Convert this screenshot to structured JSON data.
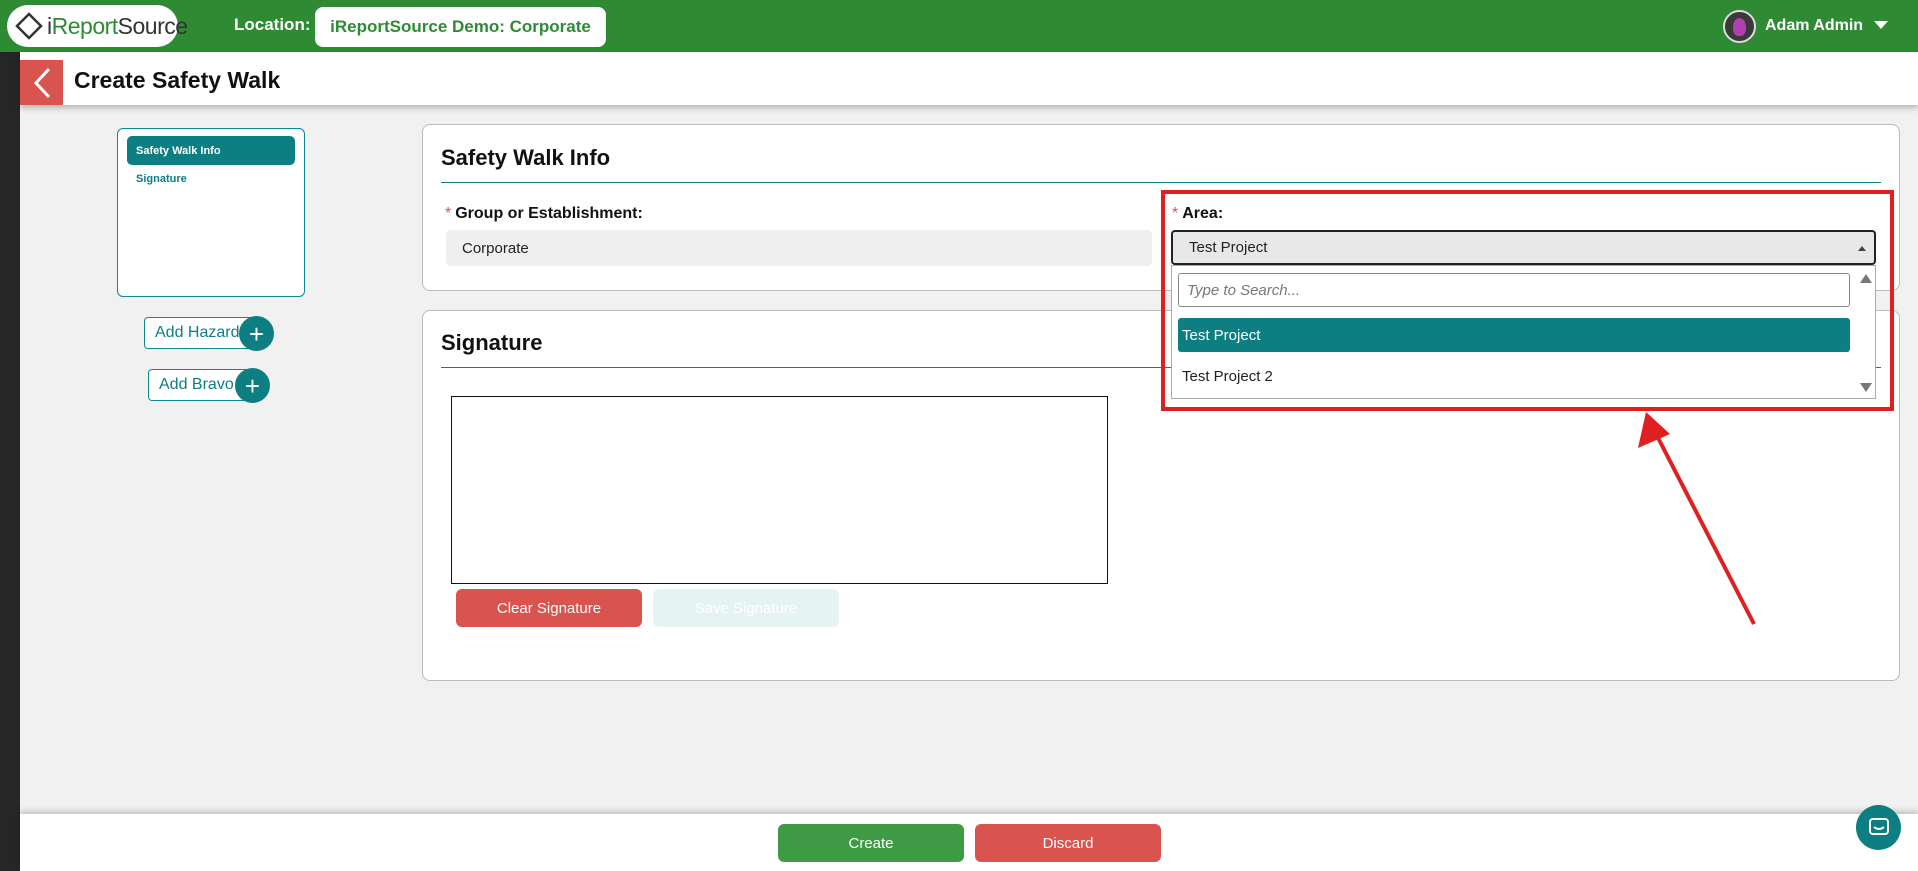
{
  "topbar": {
    "logo_prefix": "i",
    "logo_main": "Report",
    "logo_suffix": "Source",
    "location_label": "Location:",
    "location_value": "iReportSource Demo: Corporate",
    "user_name": "Adam Admin",
    "brand_color": "#2e8b34"
  },
  "header": {
    "title": "Create Safety Walk"
  },
  "side_nav": {
    "items": [
      {
        "label": "Safety Walk Info",
        "active": true
      },
      {
        "label": "Signature",
        "active": false
      }
    ],
    "add_hazard": "Add Hazard",
    "add_bravo": "Add Bravo",
    "add_icon": "+"
  },
  "info_panel": {
    "title": "Safety Walk Info",
    "group_label": "Group or Establishment:",
    "group_value": "Corporate",
    "area_label": "Area:",
    "area_value": "Test Project",
    "required_mark": "*"
  },
  "area_dropdown": {
    "search_placeholder": "Type to Search...",
    "options": [
      {
        "label": "Test Project",
        "selected": true
      },
      {
        "label": "Test Project 2",
        "selected": false
      }
    ]
  },
  "signature_panel": {
    "title": "Signature",
    "clear_label": "Clear Signature",
    "save_label": "Save Signature"
  },
  "footer": {
    "create_label": "Create",
    "discard_label": "Discard"
  },
  "colors": {
    "accent_teal": "#0d7e82",
    "danger_red": "#d9534f",
    "annotation_red": "#e02020"
  }
}
